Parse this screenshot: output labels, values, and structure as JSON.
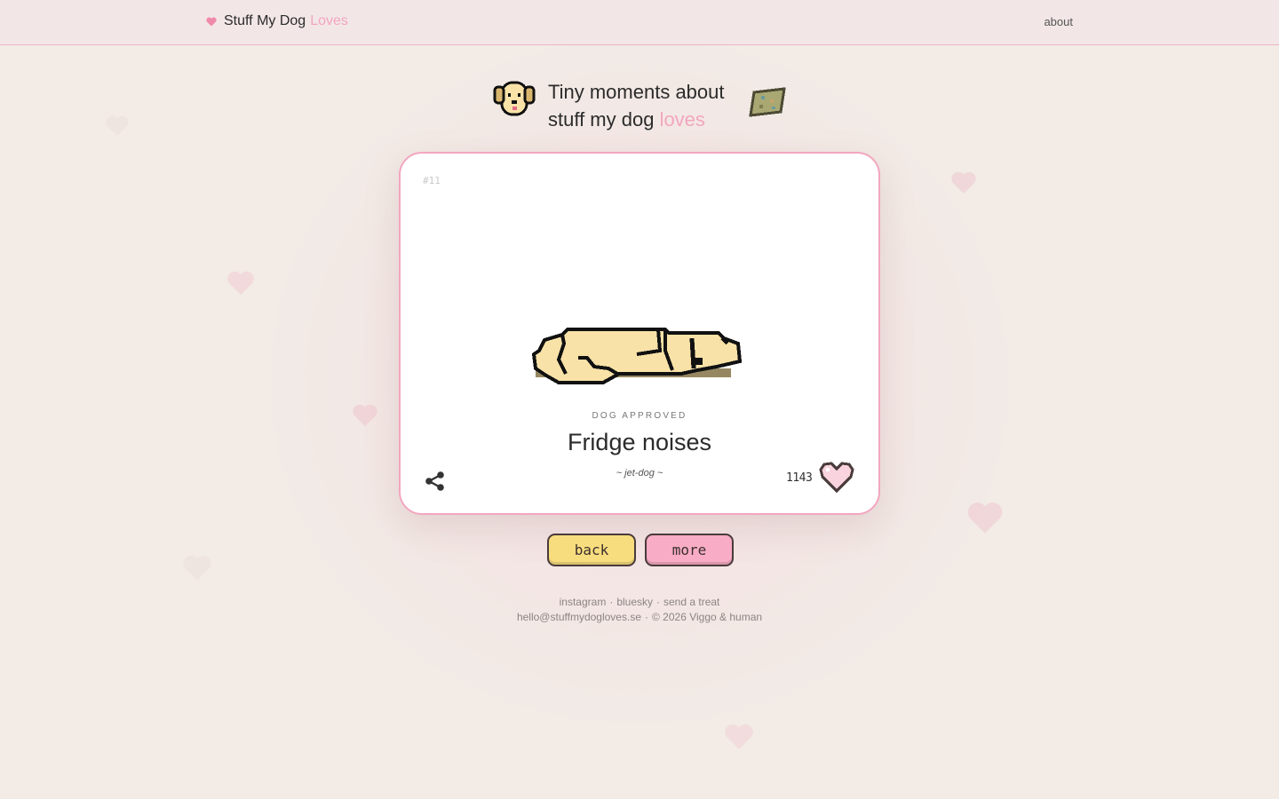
{
  "header": {
    "brand_prefix": "Stuff My Dog",
    "brand_accent": "Loves",
    "about_link": "about"
  },
  "hero": {
    "line1": "Tiny moments about",
    "line2_prefix": "stuff my dog",
    "line2_accent": "loves",
    "dog_icon": "pixel-dog-face-icon",
    "treat_icon": "pixel-treat-icon"
  },
  "card": {
    "number": "#11",
    "tag": "DOG APPROVED",
    "title": "Fridge noises",
    "author": "~ jet-dog ~",
    "likes": "1143",
    "art_icon": "pixel-sleeping-dog-icon",
    "share_icon": "share-icon",
    "like_icon": "pixel-heart-icon"
  },
  "buttons": {
    "back": "back",
    "more": "more"
  },
  "footer": {
    "links": [
      "instagram",
      "bluesky",
      "send a treat"
    ],
    "email": "hello@stuffmydogloves.se",
    "copyright": "© 2026 Viggo & human"
  },
  "colors": {
    "background": "#f2ebe6",
    "accent_pink": "#f3a6bf",
    "back_button": "#f8dd7e",
    "more_button": "#f8acc5",
    "dog_fill": "#f8e2a8",
    "outline": "#111111"
  }
}
